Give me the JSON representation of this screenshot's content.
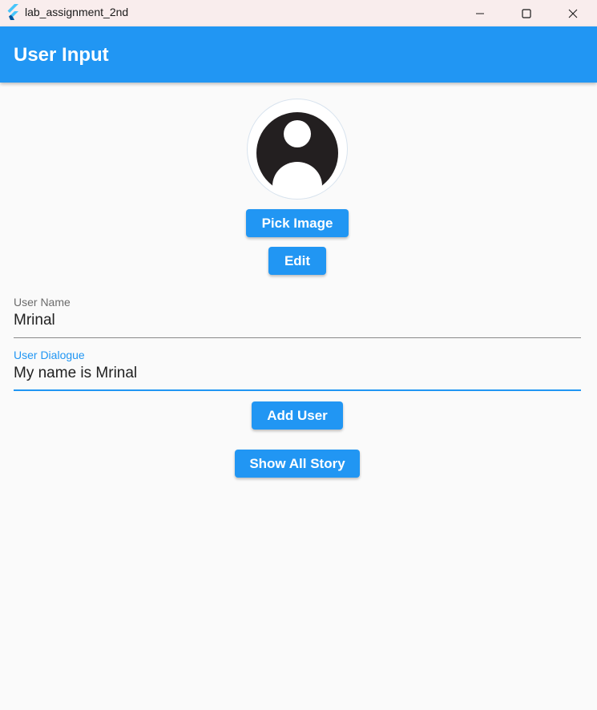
{
  "window": {
    "title": "lab_assignment_2nd",
    "controls": {
      "minimize": "—",
      "maximize": "☐",
      "close": "✕"
    }
  },
  "appbar": {
    "title": "User Input"
  },
  "buttons": {
    "pick_image": "Pick Image",
    "edit": "Edit",
    "add_user": "Add User",
    "show_all_story": "Show All Story"
  },
  "fields": {
    "user_name": {
      "label": "User Name",
      "value": "Mrinal"
    },
    "user_dialogue": {
      "label": "User Dialogue",
      "value": "My name is Mrinal"
    }
  },
  "colors": {
    "primary": "#2196f3",
    "titlebar": "#f9eded",
    "background": "#fafafa",
    "focused_label": "#2196f3",
    "unfocused_label": "#6b6b6b"
  },
  "icons": {
    "app": "flutter-icon",
    "avatar": "default-person-avatar"
  }
}
